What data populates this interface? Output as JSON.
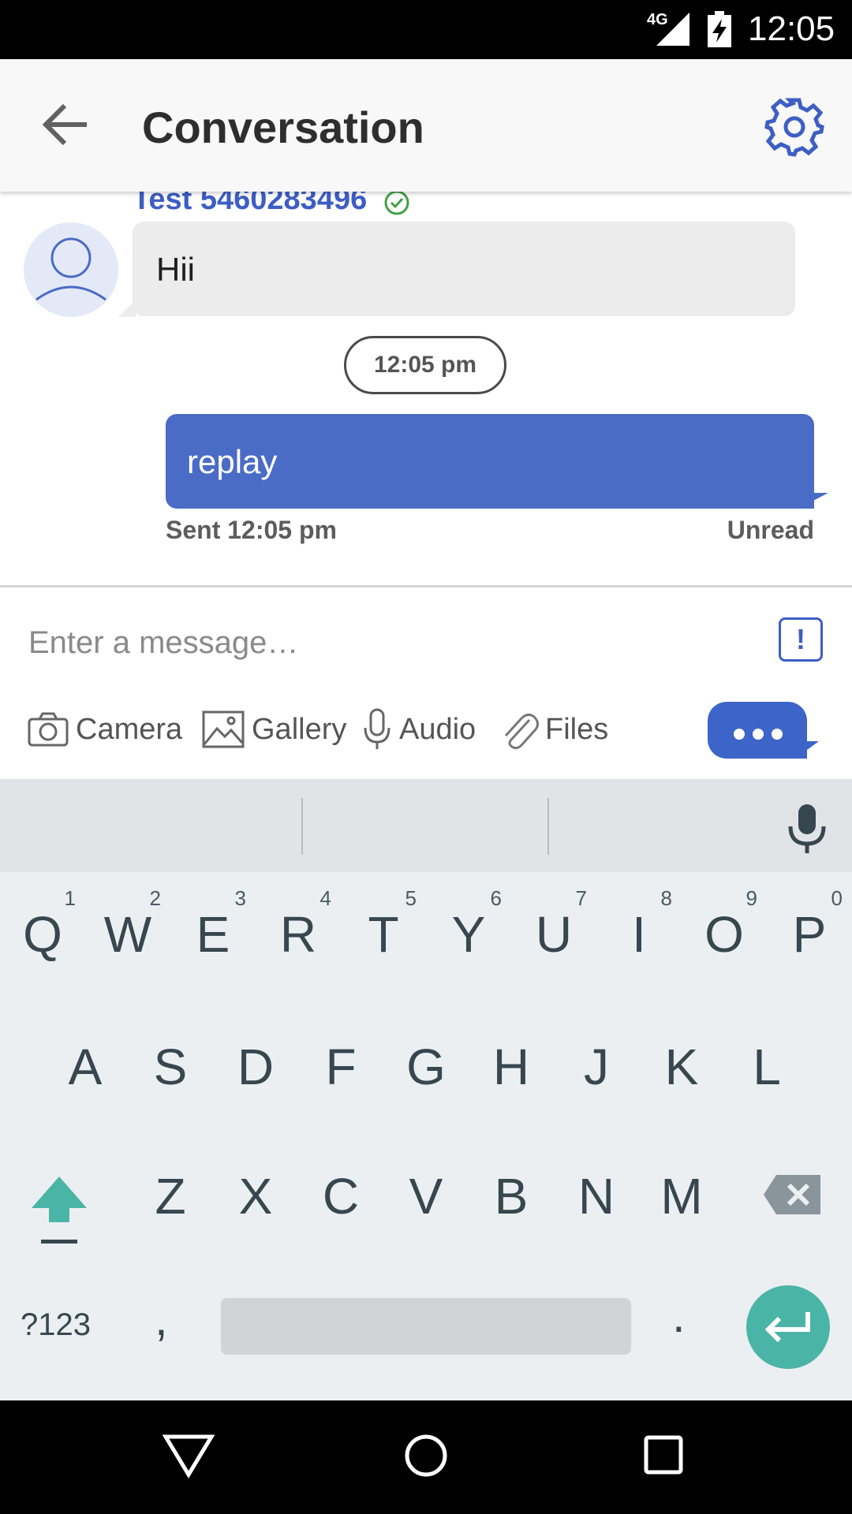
{
  "status_bar": {
    "network": "4G",
    "time": "12:05"
  },
  "app_bar": {
    "title": "Conversation",
    "back_icon": "arrow-left-icon",
    "settings_icon": "gear-icon"
  },
  "conversation": {
    "incoming": {
      "sender": "Test 5460283496",
      "text": "Hii",
      "verified": true
    },
    "timestamp": "12:05 pm",
    "outgoing": {
      "text": "replay",
      "status": "Sent 12:05 pm",
      "read_state": "Unread"
    }
  },
  "composer": {
    "placeholder": "Enter a message…",
    "priority_label": "!",
    "attachments": {
      "camera": "Camera",
      "gallery": "Gallery",
      "audio": "Audio",
      "files": "Files"
    }
  },
  "keyboard": {
    "row1": [
      {
        "key": "Q",
        "hint": "1"
      },
      {
        "key": "W",
        "hint": "2"
      },
      {
        "key": "E",
        "hint": "3"
      },
      {
        "key": "R",
        "hint": "4"
      },
      {
        "key": "T",
        "hint": "5"
      },
      {
        "key": "Y",
        "hint": "6"
      },
      {
        "key": "U",
        "hint": "7"
      },
      {
        "key": "I",
        "hint": "8"
      },
      {
        "key": "O",
        "hint": "9"
      },
      {
        "key": "P",
        "hint": "0"
      }
    ],
    "row2": [
      "A",
      "S",
      "D",
      "F",
      "G",
      "H",
      "J",
      "K",
      "L"
    ],
    "row3": [
      "Z",
      "X",
      "C",
      "V",
      "B",
      "N",
      "M"
    ],
    "symbols_label": "?123",
    "comma": ",",
    "period": "."
  },
  "colors": {
    "brand_blue": "#3d5ec4",
    "outgoing_bubble": "#4a6bc6",
    "accent_teal": "#4ab5a7"
  }
}
